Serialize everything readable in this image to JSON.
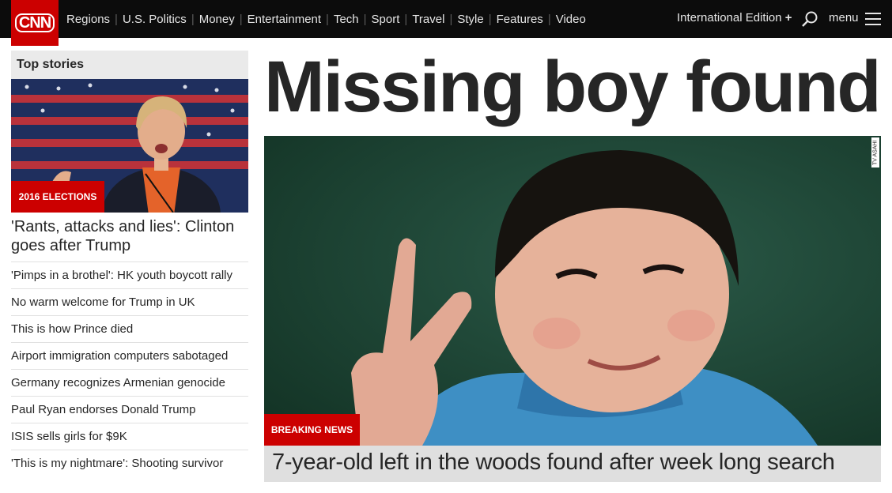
{
  "header": {
    "logo_text": "CNN",
    "nav": [
      "Regions",
      "U.S. Politics",
      "Money",
      "Entertainment",
      "Tech",
      "Sport",
      "Travel",
      "Style",
      "Features",
      "Video"
    ],
    "edition_label": "International Edition",
    "edition_plus": "+",
    "menu_label": "menu",
    "brand_color": "#cc0000"
  },
  "sidebar": {
    "title": "Top stories",
    "lead": {
      "badge": "2016 ELECTIONS",
      "headline": "'Rants, attacks and lies': Clinton goes after Trump"
    },
    "stories": [
      "'Pimps in a brothel': HK youth boycott rally",
      "No warm welcome for Trump in UK",
      "This is how Prince died",
      "Airport immigration computers sabotaged",
      "Germany recognizes Armenian genocide",
      "Paul Ryan endorses Donald Trump",
      "ISIS sells girls for $9K",
      "'This is my nightmare': Shooting survivor"
    ]
  },
  "main": {
    "headline": "Missing boy found",
    "image_credit": "TV ASAHI",
    "badge": "BREAKING NEWS",
    "caption": "7-year-old left in the woods found after week long search"
  }
}
